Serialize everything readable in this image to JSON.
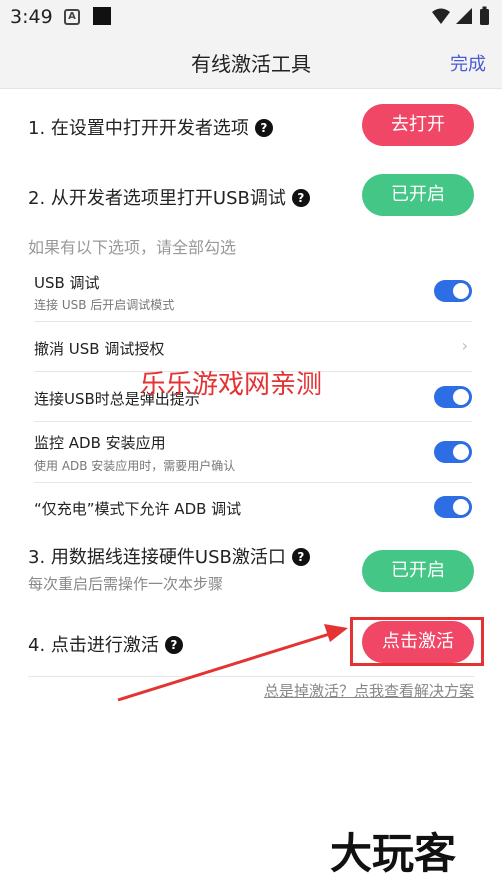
{
  "status_bar": {
    "time": "3:49",
    "a_icon": "A"
  },
  "header": {
    "title": "有线激活工具",
    "done": "完成"
  },
  "steps": [
    {
      "label": "1. 在设置中打开开发者选项",
      "button": "去打开"
    },
    {
      "label": "2. 从开发者选项里打开USB调试",
      "button": "已开启"
    },
    {
      "label": "3. 用数据线连接硬件USB激活口",
      "sub": "每次重启后需操作一次本步骤",
      "button": "已开启"
    },
    {
      "label": "4. 点击进行激活",
      "button": "点击激活"
    }
  ],
  "options_hint": "如果有以下选项，请全部勾选",
  "options": [
    {
      "title": "USB 调试",
      "sub": "连接 USB 后开启调试模式",
      "control": "toggle-on"
    },
    {
      "title": "撤消 USB 调试授权",
      "control": "chevron"
    },
    {
      "title": "连接USB时总是弹出提示",
      "control": "toggle-on"
    },
    {
      "title": "监控 ADB 安装应用",
      "sub": "使用 ADB 安装应用时，需要用户确认",
      "control": "toggle-on"
    },
    {
      "title": "“仅充电”模式下允许 ADB 调试",
      "control": "toggle-on"
    }
  ],
  "watermark": "乐乐游戏网亲测",
  "help_link": "总是掉激活？点我查看解决方案",
  "logo": "大玩客",
  "colors": {
    "red_button": "#ef4765",
    "green_button": "#44c686",
    "toggle_on": "#2d6ee4",
    "accent_link": "#4a5bd4",
    "annotation_red": "#e53333"
  }
}
